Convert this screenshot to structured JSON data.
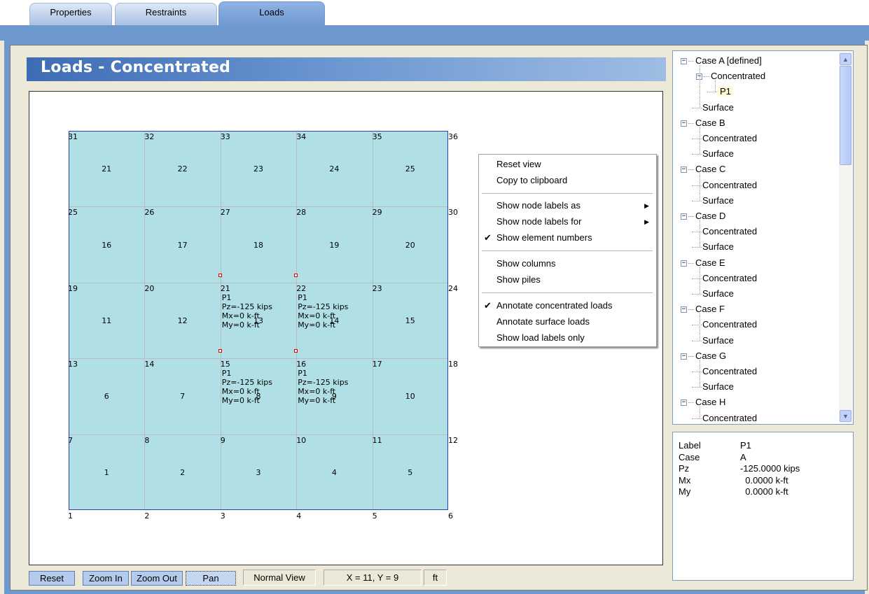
{
  "tabs": [
    {
      "label": "Properties",
      "active": false
    },
    {
      "label": "Restraints",
      "active": false
    },
    {
      "label": "Loads",
      "active": true
    }
  ],
  "header": {
    "title": "Loads - Concentrated"
  },
  "grid": {
    "node_labels": [
      "1",
      "2",
      "3",
      "4",
      "5",
      "6",
      "7",
      "8",
      "9",
      "10",
      "11",
      "12",
      "13",
      "14",
      "15",
      "16",
      "17",
      "18",
      "19",
      "20",
      "21",
      "22",
      "23",
      "24",
      "25",
      "26",
      "27",
      "28",
      "29",
      "30",
      "31",
      "32",
      "33",
      "34",
      "35",
      "36"
    ],
    "element_numbers": [
      "1",
      "2",
      "3",
      "4",
      "5",
      "6",
      "7",
      "8",
      "9",
      "10",
      "11",
      "12",
      "13",
      "14",
      "15",
      "16",
      "17",
      "18",
      "19",
      "20",
      "21",
      "22",
      "23",
      "24",
      "25"
    ],
    "loads": [
      {
        "node": "21",
        "text": "P1\nPz=-125 kips\nMx=0 k-ft\nMy=0 k-ft"
      },
      {
        "node": "22",
        "text": "P1\nPz=-125 kips\nMx=0 k-ft\nMy=0 k-ft"
      },
      {
        "node": "15",
        "text": "P1\nPz=-125 kips\nMx=0 k-ft\nMy=0 k-ft"
      },
      {
        "node": "16",
        "text": "P1\nPz=-125 kips\nMx=0 k-ft\nMy=0 k-ft"
      }
    ],
    "colors": {
      "fill": "#b0dfe6",
      "border": "#2b3fb0",
      "marker": "#e00000"
    }
  },
  "context_menu": {
    "items": [
      {
        "label": "Reset view"
      },
      {
        "label": "Copy to clipboard"
      },
      {
        "label": "Show node labels as",
        "submenu": true
      },
      {
        "label": "Show node labels for",
        "submenu": true
      },
      {
        "label": "Show element numbers",
        "checked": true
      },
      {
        "label": "Show columns"
      },
      {
        "label": "Show piles"
      },
      {
        "label": "Annotate concentrated loads",
        "checked": true
      },
      {
        "label": "Annotate surface loads"
      },
      {
        "label": "Show load labels only"
      }
    ],
    "check_glyph": "✔",
    "arrow_glyph": "▶"
  },
  "toolbar": {
    "reset": "Reset",
    "zoom_in": "Zoom In",
    "zoom_out": "Zoom Out",
    "pan": "Pan",
    "view_mode": "Normal View",
    "coords": "X = 11, Y = 9",
    "units": "ft"
  },
  "tree": {
    "expander_glyph": "−",
    "items": [
      {
        "label": "Case A [defined]"
      },
      {
        "label": "Concentrated"
      },
      {
        "label": "P1",
        "selected": true
      },
      {
        "label": "Surface"
      },
      {
        "label": "Case B"
      },
      {
        "label": "Concentrated"
      },
      {
        "label": "Surface"
      },
      {
        "label": "Case C"
      },
      {
        "label": "Concentrated"
      },
      {
        "label": "Surface"
      },
      {
        "label": "Case D"
      },
      {
        "label": "Concentrated"
      },
      {
        "label": "Surface"
      },
      {
        "label": "Case E"
      },
      {
        "label": "Concentrated"
      },
      {
        "label": "Surface"
      },
      {
        "label": "Case F"
      },
      {
        "label": "Concentrated"
      },
      {
        "label": "Surface"
      },
      {
        "label": "Case G"
      },
      {
        "label": "Concentrated"
      },
      {
        "label": "Surface"
      },
      {
        "label": "Case H"
      },
      {
        "label": "Concentrated"
      }
    ],
    "scroll_up": "▲",
    "scroll_down": "▼"
  },
  "properties": [
    {
      "key": "Label",
      "value": "P1"
    },
    {
      "key": "Case",
      "value": "A"
    },
    {
      "key": "Pz",
      "value": "-125.0000 kips"
    },
    {
      "key": "Mx",
      "value": "  0.0000 k-ft"
    },
    {
      "key": "My",
      "value": "  0.0000 k-ft"
    }
  ]
}
